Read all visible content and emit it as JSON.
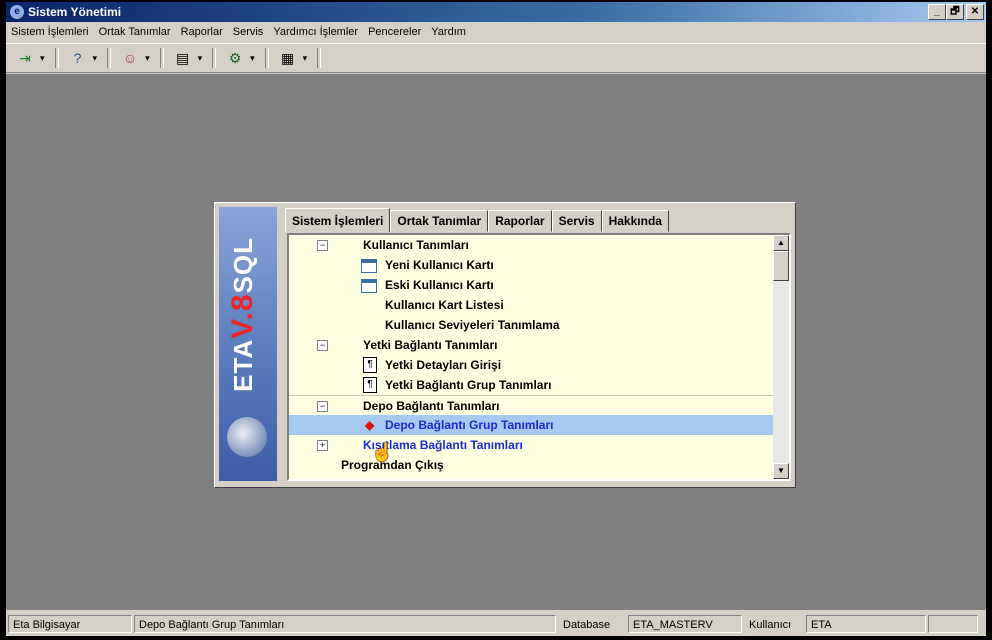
{
  "window": {
    "title": "Sistem Yönetimi",
    "min": "_",
    "max": "🗗",
    "close": "✕"
  },
  "menu": [
    "Sistem İşlemleri",
    "Ortak Tanımlar",
    "Raporlar",
    "Servis",
    "Yardımcı İşlemler",
    "Pencereler",
    "Yardım"
  ],
  "toolbar": {
    "icons": [
      "exit-icon",
      "help-icon",
      "users-icon",
      "book-icon",
      "tools-icon",
      "tables-icon"
    ],
    "dropdown_glyph": "▾"
  },
  "dialog": {
    "logo": {
      "brand": "ETA",
      "version": "V.8",
      "suffix": "SQL"
    },
    "tabs": [
      "Sistem İşlemleri",
      "Ortak Tanımlar",
      "Raporlar",
      "Servis",
      "Hakkında"
    ],
    "active_tab": "Sistem İşlemleri",
    "tree": {
      "group1": {
        "label": "Kullanıcı Tanımları",
        "expander": "−"
      },
      "item1": "Yeni Kullanıcı Kartı",
      "item2": "Eski Kullanıcı Kartı",
      "item3": "Kullanıcı Kart Listesi",
      "item4": "Kullanıcı Seviyeleri Tanımlama",
      "group2": {
        "label": "Yetki Bağlantı Tanımları",
        "expander": "−"
      },
      "item5": "Yetki Detayları Girişi",
      "item6": "Yetki Bağlantı Grup Tanımları",
      "group3": {
        "label": "Depo Bağlantı Tanımları",
        "expander": "−"
      },
      "item7": "Depo Bağlantı Grup Tanımları",
      "group4": {
        "label": "Kısıtlama Bağlantı Tanımları",
        "expander": "+"
      },
      "exit": "Programdan Çıkış"
    },
    "selected_item": "Depo Bağlantı Grup Tanımları"
  },
  "status": {
    "company": "Eta Bilgisayar",
    "current": "Depo Bağlantı Grup Tanımları",
    "db_label": "Database",
    "db_value": "ETA_MASTERV",
    "user_label": "Kullanıcı",
    "user_value": "ETA"
  }
}
